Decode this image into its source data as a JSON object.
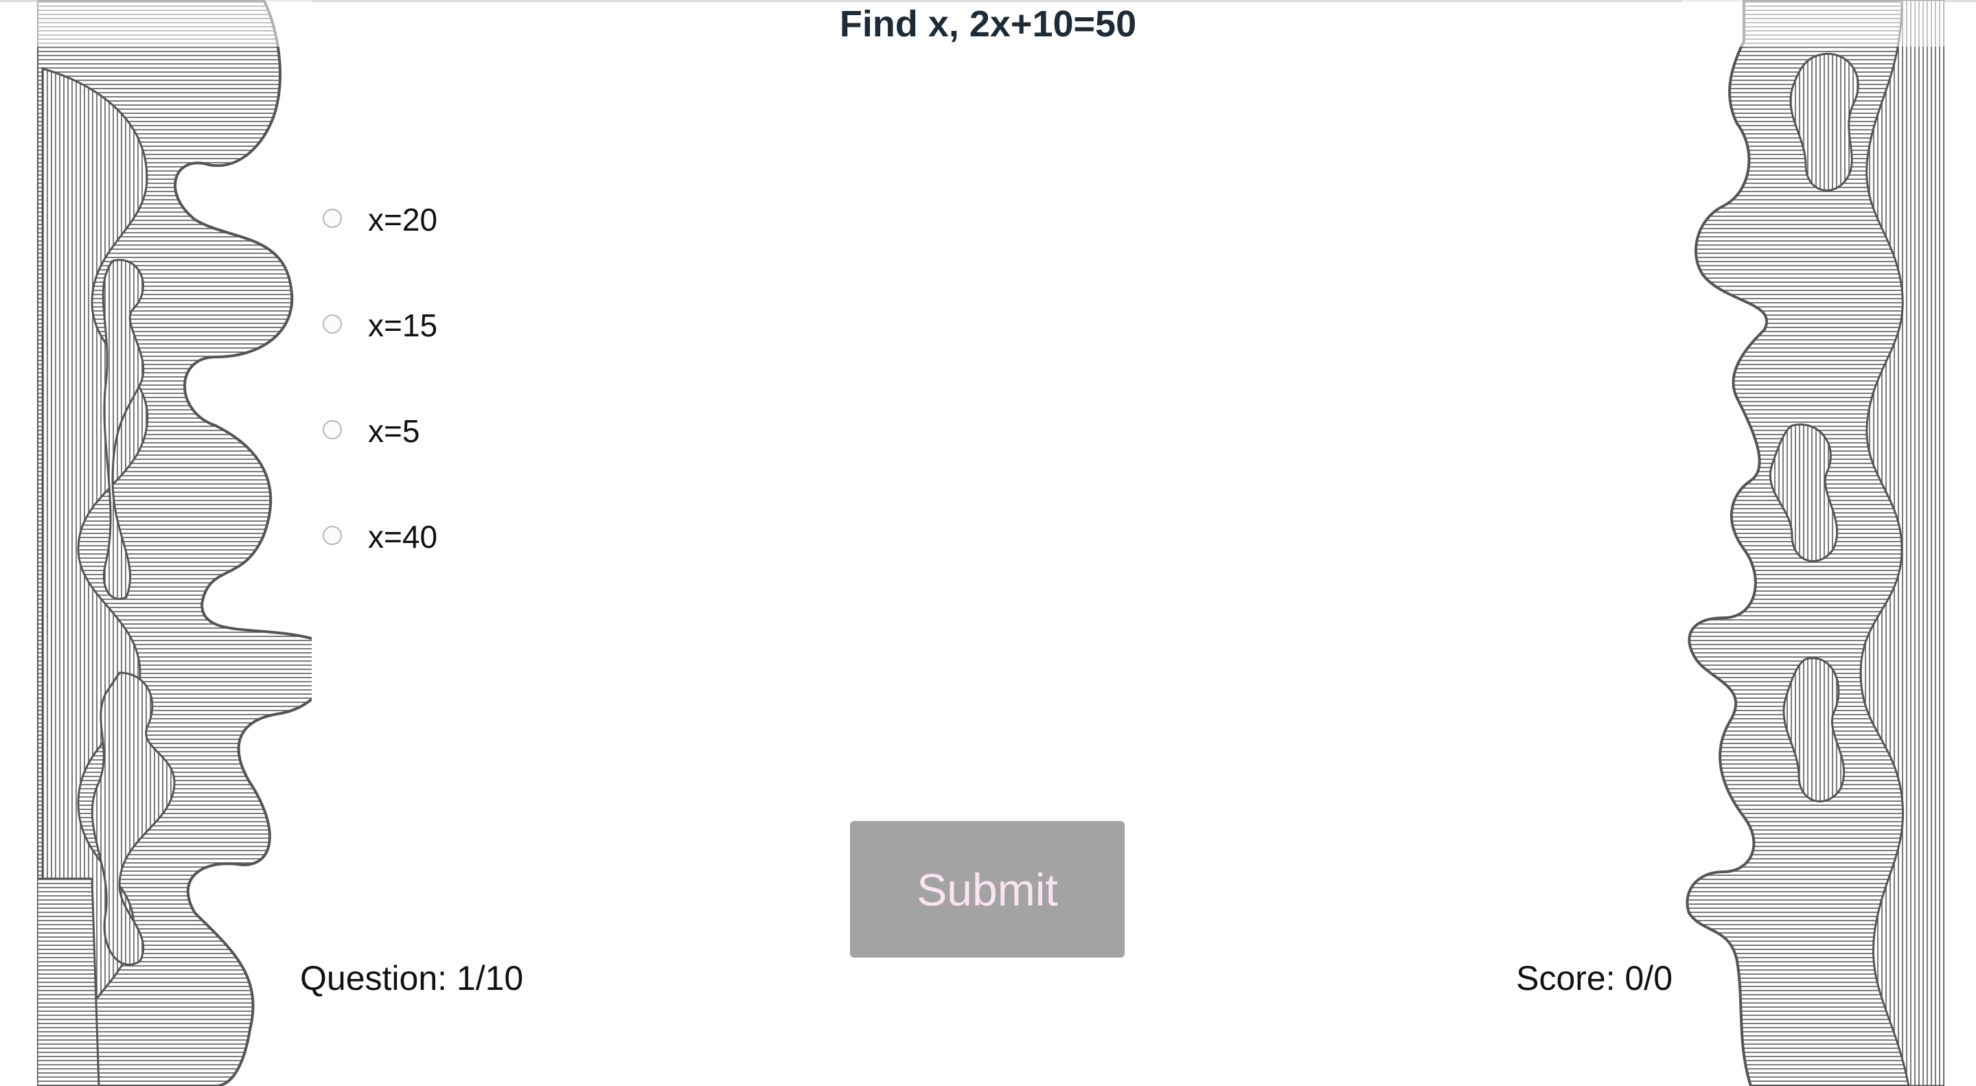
{
  "quiz": {
    "question": "Find x, 2x+10=50",
    "answers": [
      {
        "label": "x=20"
      },
      {
        "label": "x=15"
      },
      {
        "label": "x=5"
      },
      {
        "label": "x=40"
      }
    ],
    "submit_label": "Submit",
    "question_counter": "Question: 1/10",
    "score": "Score: 0/0"
  },
  "decor": {
    "left_border": "puzzle-pieces-border",
    "right_border": "puzzle-pieces-border"
  },
  "colors": {
    "title": "#1d2b36",
    "submit_bg": "#a3a3a3",
    "submit_text": "#fbe4f2"
  }
}
